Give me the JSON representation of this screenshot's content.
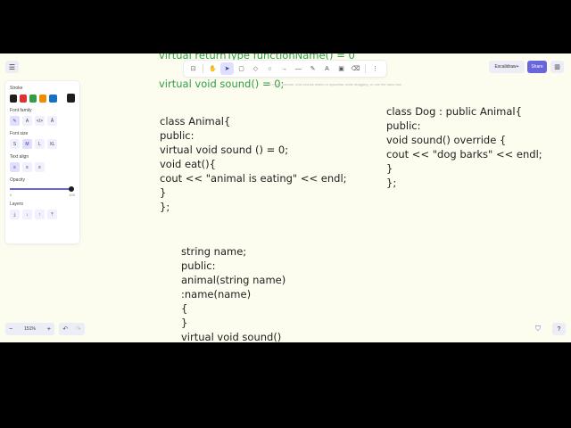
{
  "canvas_text": {
    "green_line_1": "virtual returnType functionName() = 0",
    "green_line_2": "virtual void sound() = 0;",
    "animal_class": "class Animal{\npublic:\nvirtual void sound () = 0;\nvoid eat(){\ncout << \"animal is eating\" << endl;\n}\n};",
    "dog_class": "class Dog : public Animal{\npublic:\nvoid sound() override {\ncout << \"dog barks\" << endl;\n}\n};",
    "animal_members": "string name;\npublic:\nanimal(string name)\n:name(name)\n{\n}\nvirtual void sound()"
  },
  "toolbar": {
    "hint": "To move canvas, hold mouse wheel or spacebar while dragging, or use the hand tool"
  },
  "panel": {
    "stroke_label": "Stroke",
    "font_family_label": "Font family",
    "font_size_label": "Font size",
    "text_align_label": "Text align",
    "opacity_label": "Opacity",
    "opacity_min": "0",
    "opacity_max": "100",
    "layers_label": "Layers",
    "font_sizes": [
      "S",
      "M",
      "L",
      "XL"
    ],
    "stroke_colors": [
      "#1e1e1e",
      "#e03131",
      "#2f9e44",
      "#f08c00",
      "#1971c2"
    ],
    "selected_color": "#1e1e1e"
  },
  "top_right": {
    "library_label": "Excalidraw+",
    "share_label": "Share"
  },
  "bottom": {
    "zoom_value": "151%",
    "zoom_out": "−",
    "zoom_in": "+"
  }
}
